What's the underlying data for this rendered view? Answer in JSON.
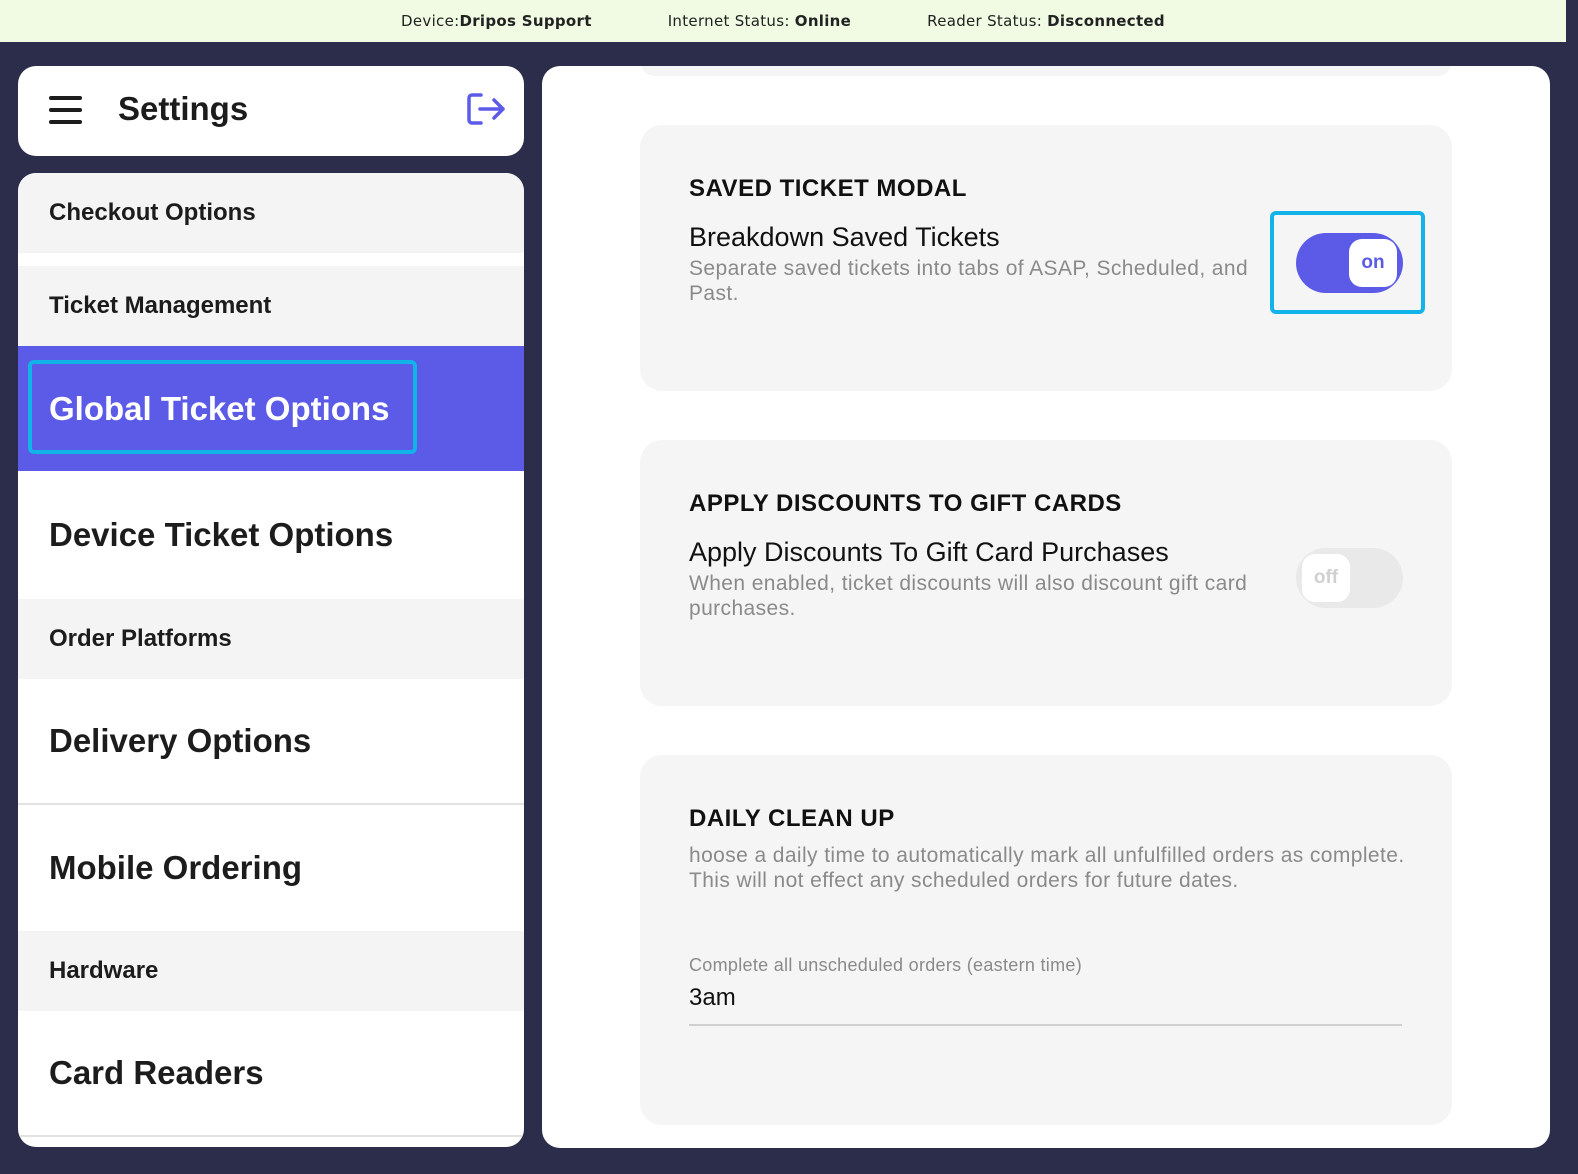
{
  "status_bar": {
    "device_label": "Device:",
    "device_value": "Dripos Support",
    "internet_label": "Internet Status:",
    "internet_value": "Online",
    "reader_label": "Reader Status:",
    "reader_value": "Disconnected"
  },
  "sidebar": {
    "title": "Settings",
    "menu_icon": "hamburger-menu-icon",
    "logout_icon": "logout-arrow-icon",
    "items": [
      {
        "label": "Checkout Options"
      },
      {
        "label": "Ticket Management"
      },
      {
        "label": "Global Ticket Options",
        "active": true
      },
      {
        "label": "Device Ticket Options"
      },
      {
        "label": "Order Platforms"
      },
      {
        "label": "Delivery Options"
      },
      {
        "label": "Mobile Ordering"
      },
      {
        "label": "Hardware"
      },
      {
        "label": "Card Readers"
      }
    ]
  },
  "main": {
    "saved_ticket": {
      "heading": "SAVED TICKET MODAL",
      "label": "Breakdown Saved Tickets",
      "description": "Separate saved tickets into tabs of ASAP, Scheduled, and Past.",
      "toggle": "on"
    },
    "gift_cards": {
      "heading": "APPLY DISCOUNTS TO GIFT CARDS",
      "label": "Apply Discounts To Gift Card Purchases",
      "description": "When enabled, ticket discounts will also discount gift card purchases.",
      "toggle": "off"
    },
    "daily_cleanup": {
      "heading": "DAILY CLEAN UP",
      "description": "hoose a daily time to automatically mark all unfulfilled orders as complete. This will not effect any scheduled orders for future dates.",
      "field_label": "Complete all unscheduled orders (eastern time)",
      "field_value": "3am"
    }
  },
  "colors": {
    "accent": "#5b5be8",
    "highlight": "#11b3e8",
    "frame": "#2b2d4a",
    "status_bar_bg": "#f1fbe3"
  }
}
